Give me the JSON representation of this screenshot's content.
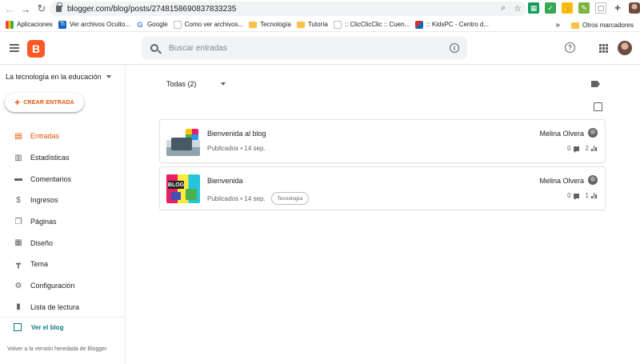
{
  "browser": {
    "url": "blogger.com/blog/posts/2748158690837833235",
    "bookmarks": [
      {
        "label": "Aplicaciones",
        "color": "#4285f4",
        "glyph": "apps-icon"
      },
      {
        "label": "Ver archivos Oculto...",
        "color": "#1565c0",
        "glyph": "ti-icon"
      },
      {
        "label": "Google",
        "color": "#ffffff",
        "glyph": "google-icon"
      },
      {
        "label": "Como ver archivos...",
        "color": "#ffffff",
        "glyph": "page-icon"
      },
      {
        "label": "Tecnología",
        "color": "#f6c344",
        "glyph": "folder-icon"
      },
      {
        "label": "Tutoría",
        "color": "#f6c344",
        "glyph": "folder-icon"
      },
      {
        "label": ":: ClicClicClic :: Cuen...",
        "color": "#ffffff",
        "glyph": "page-icon"
      },
      {
        "label": ":: KidsPC - Centro d...",
        "color": "#d32f2f",
        "glyph": "kidspc-icon"
      }
    ],
    "other_bookmarks": "Otros marcadores",
    "more_bookmarks": "»"
  },
  "header": {
    "logo_letter": "B",
    "search_placeholder": "Buscar entradas",
    "info_glyph": "i",
    "help_glyph": "?"
  },
  "sidebar": {
    "blog_name": "La tecnología en la educación",
    "create_label": "CREAR ENTRADA",
    "items": [
      {
        "label": "Entradas",
        "icon": "posts-icon",
        "glyph": "▤",
        "active": true
      },
      {
        "label": "Estadísticas",
        "icon": "stats-icon",
        "glyph": "▥",
        "active": false
      },
      {
        "label": "Comentarios",
        "icon": "comments-icon",
        "glyph": "▬",
        "active": false
      },
      {
        "label": "Ingresos",
        "icon": "dollar-icon",
        "glyph": "$",
        "active": false
      },
      {
        "label": "Páginas",
        "icon": "pages-icon",
        "glyph": "❐",
        "active": false
      },
      {
        "label": "Diseño",
        "icon": "layout-icon",
        "glyph": "▦",
        "active": false
      },
      {
        "label": "Tema",
        "icon": "theme-icon",
        "glyph": "┳",
        "active": false
      },
      {
        "label": "Configuración",
        "icon": "gear-icon",
        "glyph": "⚙",
        "active": false
      },
      {
        "label": "Lista de lectura",
        "icon": "bookmark-icon",
        "glyph": "▮",
        "active": false
      }
    ],
    "view_blog": "Ver el blog",
    "legacy_link": "Volver a la versión heredada de Blogger"
  },
  "main": {
    "filter_label": "Todas (2)",
    "posts": [
      {
        "title": "Bienvenida al blog",
        "status": "Publicados • 14 sep.",
        "tag": "",
        "author": "Melina Olvera",
        "comments": "0",
        "views": "2"
      },
      {
        "title": "Bienvenida",
        "status": "Publicados • 14 sep.",
        "tag": "Tecnología",
        "author": "Melina Olvera",
        "comments": "0",
        "views": "1"
      }
    ]
  },
  "colors": {
    "brand": "#ff5722",
    "active": "#e65100",
    "link": "#0b7a87"
  }
}
